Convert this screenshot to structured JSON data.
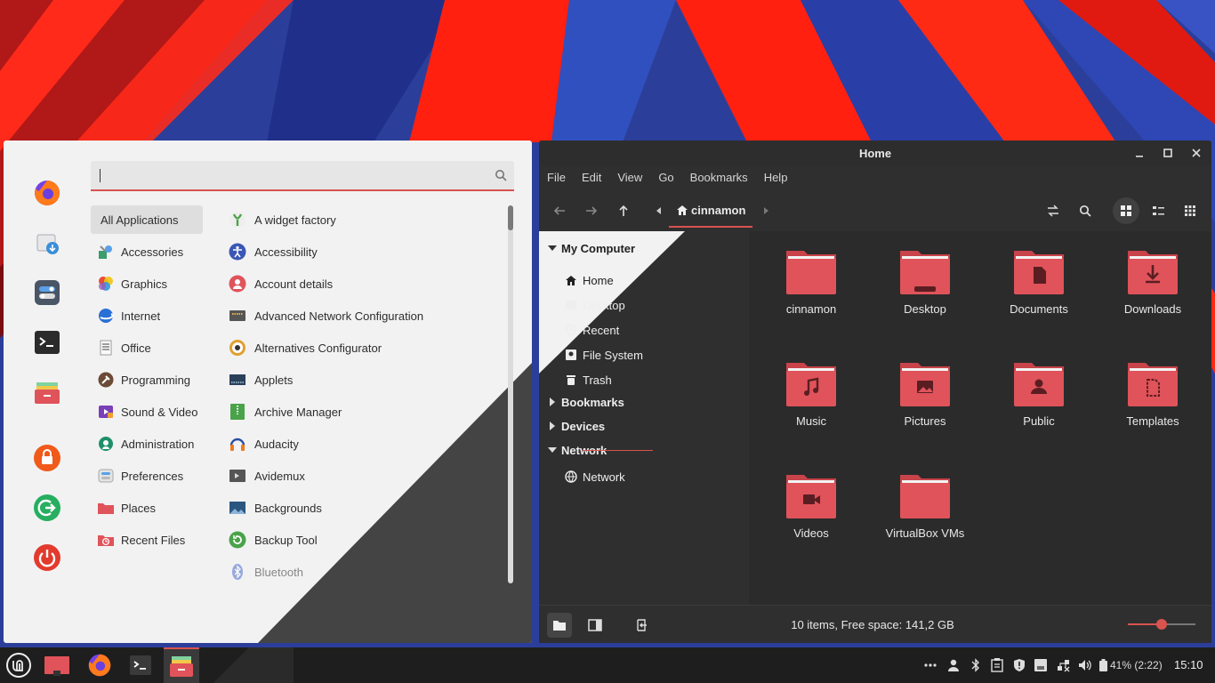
{
  "colors": {
    "accent": "#d9534f",
    "folder": "#e0535a",
    "menu_bg": "#f2f2f2",
    "dark_bg": "#2f2f2f",
    "panel_bg": "#1e1e1e"
  },
  "menu": {
    "favorites": [
      "firefox-icon",
      "software-installer-icon",
      "settings-toggle-icon",
      "terminal-icon",
      "file-manager-icon",
      "lock-screen-icon",
      "logout-icon",
      "power-icon"
    ],
    "search": {
      "value": "",
      "placeholder": ""
    },
    "categories": [
      {
        "label": "All Applications",
        "icon": "none",
        "active": true
      },
      {
        "label": "Accessories",
        "icon": "accessories-icon"
      },
      {
        "label": "Graphics",
        "icon": "graphics-icon"
      },
      {
        "label": "Internet",
        "icon": "internet-icon"
      },
      {
        "label": "Office",
        "icon": "office-icon"
      },
      {
        "label": "Programming",
        "icon": "programming-icon"
      },
      {
        "label": "Sound & Video",
        "icon": "sound-video-icon"
      },
      {
        "label": "Administration",
        "icon": "administration-icon"
      },
      {
        "label": "Preferences",
        "icon": "preferences-icon"
      },
      {
        "label": "Places",
        "icon": "places-icon"
      },
      {
        "label": "Recent Files",
        "icon": "recent-files-icon"
      }
    ],
    "apps": [
      {
        "label": "A widget factory",
        "icon": "widget-factory-icon"
      },
      {
        "label": "Accessibility",
        "icon": "accessibility-icon"
      },
      {
        "label": "Account details",
        "icon": "account-icon"
      },
      {
        "label": "Advanced Network Configuration",
        "icon": "network-config-icon"
      },
      {
        "label": "Alternatives Configurator",
        "icon": "alternatives-icon"
      },
      {
        "label": "Applets",
        "icon": "applets-icon"
      },
      {
        "label": "Archive Manager",
        "icon": "archive-icon"
      },
      {
        "label": "Audacity",
        "icon": "audacity-icon"
      },
      {
        "label": "Avidemux",
        "icon": "avidemux-icon"
      },
      {
        "label": "Backgrounds",
        "icon": "backgrounds-icon"
      },
      {
        "label": "Backup Tool",
        "icon": "backup-icon"
      },
      {
        "label": "Bluetooth",
        "icon": "bluetooth-icon",
        "faded": true
      }
    ]
  },
  "file_manager": {
    "title": "Home",
    "menubar": [
      "File",
      "Edit",
      "View",
      "Go",
      "Bookmarks",
      "Help"
    ],
    "breadcrumb": "cinnamon",
    "sidebar": {
      "my_computer": "My Computer",
      "my_computer_items": [
        {
          "label": "Home",
          "icon": "home-icon"
        },
        {
          "label": "Desktop",
          "icon": "desktop-icon"
        },
        {
          "label": "Recent",
          "icon": "recent-icon"
        },
        {
          "label": "File System",
          "icon": "drive-icon"
        },
        {
          "label": "Trash",
          "icon": "trash-icon"
        }
      ],
      "bookmarks": "Bookmarks",
      "devices": "Devices",
      "network": "Network",
      "network_items": [
        {
          "label": "Network",
          "icon": "network-icon"
        }
      ]
    },
    "folders": [
      {
        "label": "cinnamon",
        "emblem": "none"
      },
      {
        "label": "Desktop",
        "emblem": "desktop"
      },
      {
        "label": "Documents",
        "emblem": "document"
      },
      {
        "label": "Downloads",
        "emblem": "download"
      },
      {
        "label": "Music",
        "emblem": "music"
      },
      {
        "label": "Pictures",
        "emblem": "picture"
      },
      {
        "label": "Public",
        "emblem": "person"
      },
      {
        "label": "Templates",
        "emblem": "template"
      },
      {
        "label": "Videos",
        "emblem": "video"
      },
      {
        "label": "VirtualBox VMs",
        "emblem": "none"
      }
    ],
    "status": "10 items, Free space: 141,2 GB",
    "zoom_level": 0.5
  },
  "panel": {
    "launchers": [
      "mint-menu-icon",
      "show-desktop-icon",
      "firefox-icon",
      "terminal-icon",
      "file-manager-icon"
    ],
    "tray": [
      "more-icon",
      "user-icon",
      "bluetooth-icon",
      "clipboard-icon",
      "update-shield-icon",
      "notes-icon",
      "network-off-icon",
      "volume-icon"
    ],
    "battery": "41% (2:22)",
    "clock": "15:10"
  }
}
